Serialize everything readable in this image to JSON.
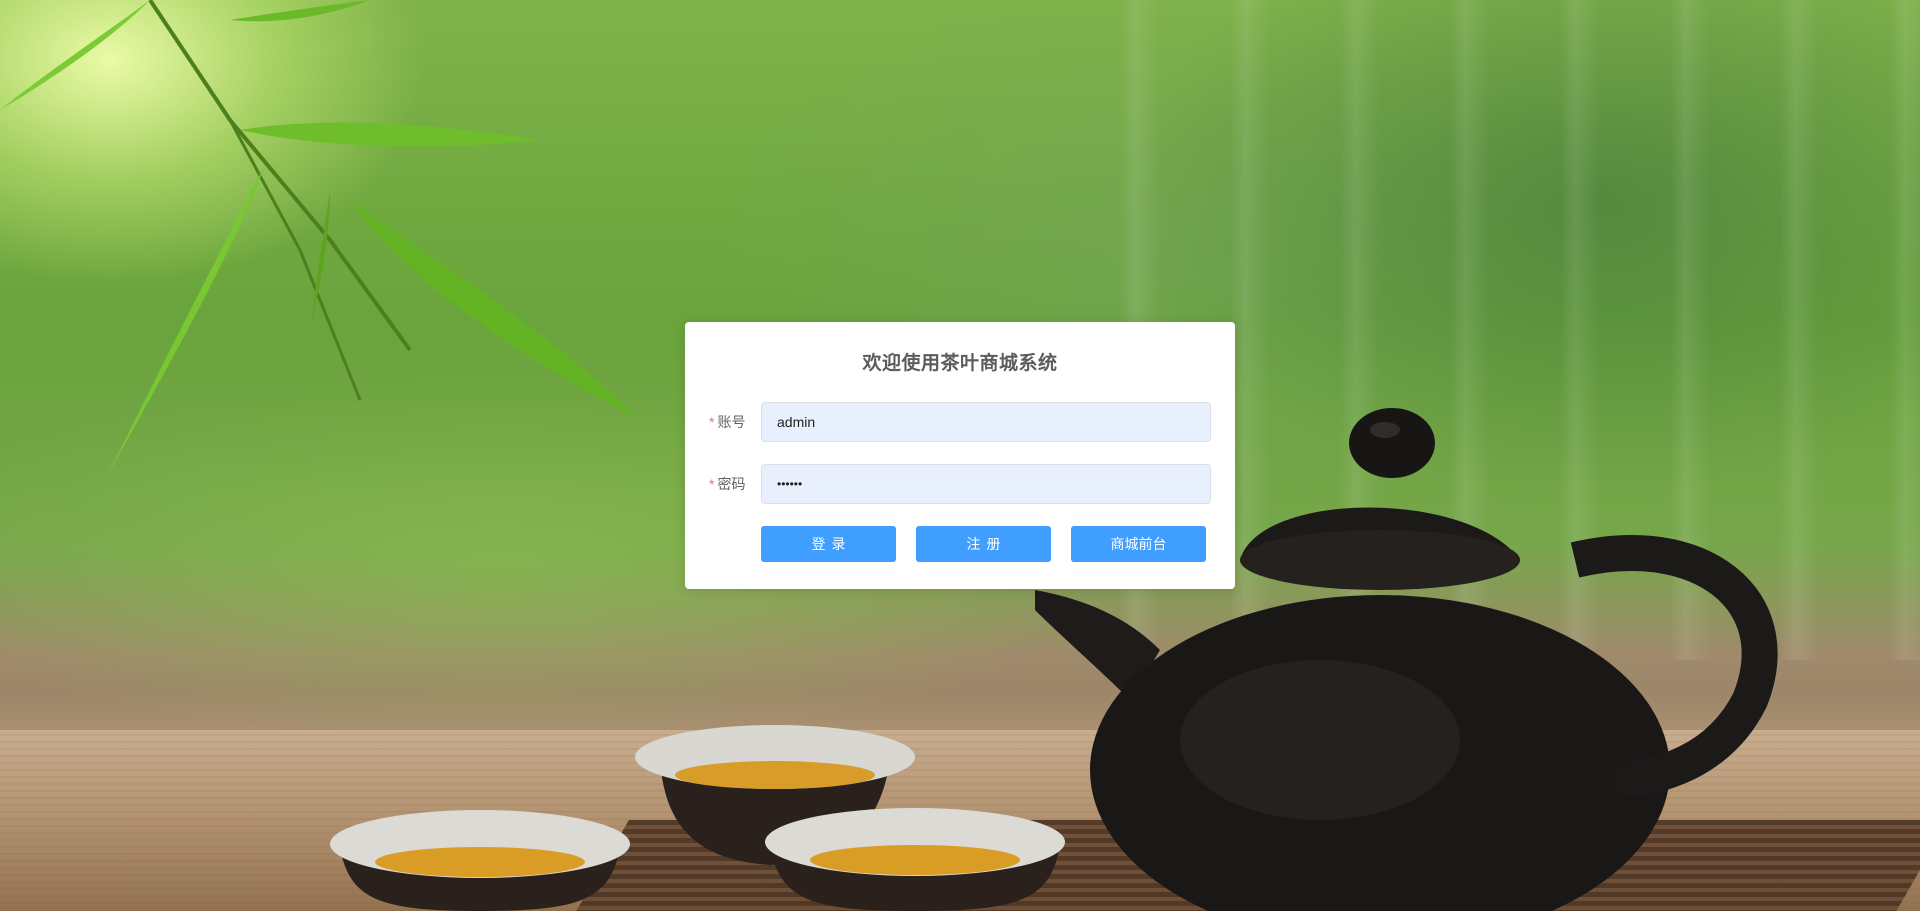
{
  "page": {
    "background_scene": "tea-set-bamboo-background"
  },
  "login": {
    "title": "欢迎使用茶叶商城系统",
    "account_label": "账号",
    "account_value": "admin",
    "password_label": "密码",
    "password_value": "••••••",
    "required_mark": "*",
    "login_button": "登录",
    "register_button": "注册",
    "shop_button": "商城前台"
  },
  "colors": {
    "primary_button": "#409eff",
    "required_star": "#f56c6c",
    "input_autofill_bg": "#e8f0fe"
  }
}
